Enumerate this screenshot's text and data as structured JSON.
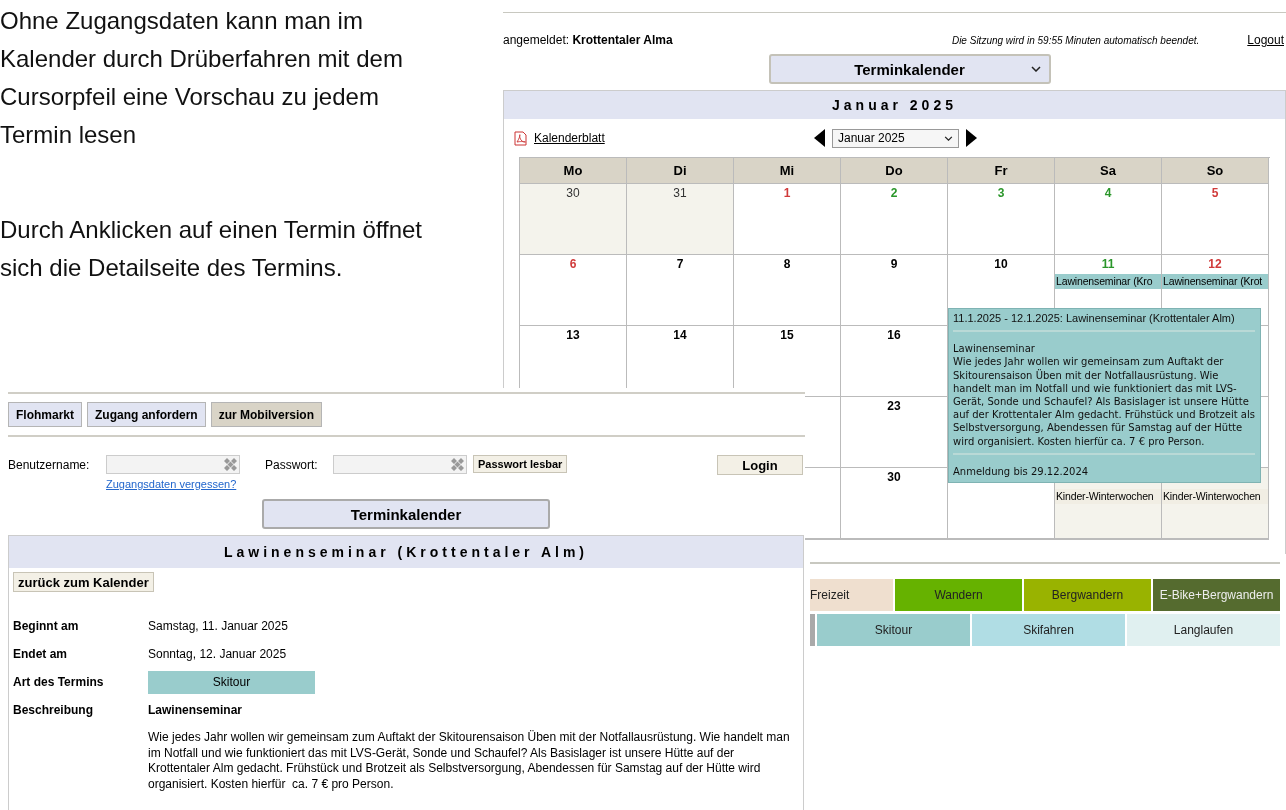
{
  "slide_text": [
    "Ohne Zugangsdaten kann man im Kalender durch Drüberfahren mit dem Cursorpfeil eine Vorschau zu jedem Termin lesen",
    "Durch Anklicken auf einen Termin öffnet sich die Detailseite des Termins."
  ],
  "calendar_page": {
    "user_label": "angemeldet:",
    "user_name": "Krottentaler Alma",
    "session_note": "Die Sitzung wird in 59:55 Minuten automatisch beendet.",
    "logout": "Logout",
    "view_select": "Terminkalender",
    "month_title": "Januar 2025",
    "pdf_link": "Kalenderblatt",
    "month_select": "Januar 2025",
    "weekdays": [
      "Mo",
      "Di",
      "Mi",
      "Do",
      "Fr",
      "Sa",
      "So"
    ],
    "weeks": [
      {
        "mo": {
          "day": "30",
          "other_month": true,
          "color": "#333333"
        },
        "di": {
          "day": "31",
          "other_month": true,
          "color": "#333333"
        },
        "mi": {
          "day": "1",
          "other_month": false,
          "color": "#d03a3a"
        },
        "do": {
          "day": "2",
          "other_month": false,
          "color": "#2a962a"
        },
        "fr": {
          "day": "3",
          "other_month": false,
          "color": "#2a962a"
        },
        "sa": {
          "day": "4",
          "other_month": false,
          "color": "#2a962a"
        },
        "so": {
          "day": "5",
          "other_month": false,
          "color": "#d03a3a"
        }
      },
      {
        "mo": {
          "day": "6",
          "other_month": false,
          "color": "#d03a3a"
        },
        "di": {
          "day": "7",
          "other_month": false,
          "color": "#000000"
        },
        "mi": {
          "day": "8",
          "other_month": false,
          "color": "#000000"
        },
        "do": {
          "day": "9",
          "other_month": false,
          "color": "#000000"
        },
        "fr": {
          "day": "10",
          "other_month": false,
          "color": "#000000"
        },
        "sa": {
          "day": "11",
          "other_month": false,
          "color": "#2a962a",
          "events": [
            {
              "label": "Lawinenseminar (Kro",
              "color": "#99cccc"
            }
          ]
        },
        "so": {
          "day": "12",
          "other_month": false,
          "color": "#d03a3a",
          "events": [
            {
              "label": "Lawinenseminar (Krot",
              "color": "#99cccc"
            }
          ]
        }
      },
      {
        "mo": {
          "day": "13",
          "other_month": false,
          "color": "#000000"
        },
        "di": {
          "day": "14",
          "other_month": false,
          "color": "#000000"
        },
        "mi": {
          "day": "15",
          "other_month": false,
          "color": "#000000"
        },
        "do": {
          "day": "16",
          "other_month": false,
          "color": "#000000"
        }
      },
      {
        "do": {
          "day": "23",
          "other_month": false,
          "color": "#000000"
        }
      },
      {
        "do": {
          "day": "30",
          "other_month": false,
          "color": "#000000"
        },
        "sa": {
          "other_month": true,
          "events": [
            {
              "label": "Kinder-Winterwochen",
              "color": "#f1eee4"
            }
          ]
        },
        "so": {
          "other_month": true,
          "events": [
            {
              "label": "Kinder-Winterwochen",
              "color": "#f1eee4"
            }
          ]
        }
      }
    ],
    "tooltip": {
      "title": "11.1.2025 - 12.1.2025: Lawinenseminar (Krottentaler Alm)",
      "name": "Lawinenseminar",
      "description": "Wie jedes Jahr wollen wir gemeinsam zum Auftakt der Skitourensaison Üben mit der Notfallausrüstung. Wie handelt man im Notfall und wie funktioniert das mit LVS-Gerät, Sonde und Schaufel? Als Basislager ist unsere Hütte auf der Krottentaler Alm gedacht. Frühstück und Brotzeit als Selbstversorgung, Abendessen für Samstag auf der Hütte wird organisiert. Kosten hierfür ca. 7 € pro Person.",
      "registration": "Anmeldung bis 29.12.2024"
    },
    "legend": [
      [
        {
          "label": "Freizeit",
          "color": "#efdfcf"
        },
        {
          "label": "Wandern",
          "color": "#66b200"
        },
        {
          "label": "Bergwandern",
          "color": "#99b300"
        },
        {
          "label": "E-Bike+Bergwandern",
          "color": "#556b2f"
        }
      ],
      [
        {
          "color": "#a9a9a9"
        },
        {
          "label": "Skitour",
          "color": "#99cccc"
        },
        {
          "label": "Skifahren",
          "color": "#b0dde4"
        },
        {
          "label": "Langlaufen",
          "color": "#e0f0f0"
        }
      ]
    ]
  },
  "detail_page": {
    "nav_buttons": [
      {
        "label": "Flohmarkt",
        "selected": false
      },
      {
        "label": "Zugang anfordern",
        "selected": false
      },
      {
        "label": "zur Mobilversion",
        "selected": true
      }
    ],
    "username_label": "Benutzername:",
    "password_label": "Passwort:",
    "show_password": "Passwort lesbar",
    "login": "Login",
    "forgot_link": "Zugangsdaten vergessen?",
    "calendar_button": "Terminkalender",
    "event_title": "Lawinenseminar (Krottentaler Alm)",
    "back_button": "zurück zum Kalender",
    "fields": [
      {
        "label": "Beginnt am",
        "value": "Samstag, 11. Januar 2025",
        "kind": "text"
      },
      {
        "label": "Endet am",
        "value": "Sonntag, 12. Januar 2025",
        "kind": "text"
      },
      {
        "label": "Art des Termins",
        "value": "Skitour",
        "kind": "category",
        "color": "#99cccc"
      },
      {
        "label": "Beschreibung",
        "value": "Lawinenseminar",
        "kind": "heading"
      }
    ],
    "description": "Wie jedes Jahr wollen wir gemeinsam zum Auftakt der Skitourensaison Üben mit der Notfallausrüstung. Wie handelt man im Notfall und wie funktioniert das mit LVS-Gerät, Sonde und Schaufel? Als Basislager ist unsere Hütte auf der Krottentaler Alm gedacht. Frühstück und Brotzeit als Selbstversorgung, Abendessen für Samstag auf der Hütte wird organisiert. Kosten hierfür  ca. 7 € pro Person."
  }
}
